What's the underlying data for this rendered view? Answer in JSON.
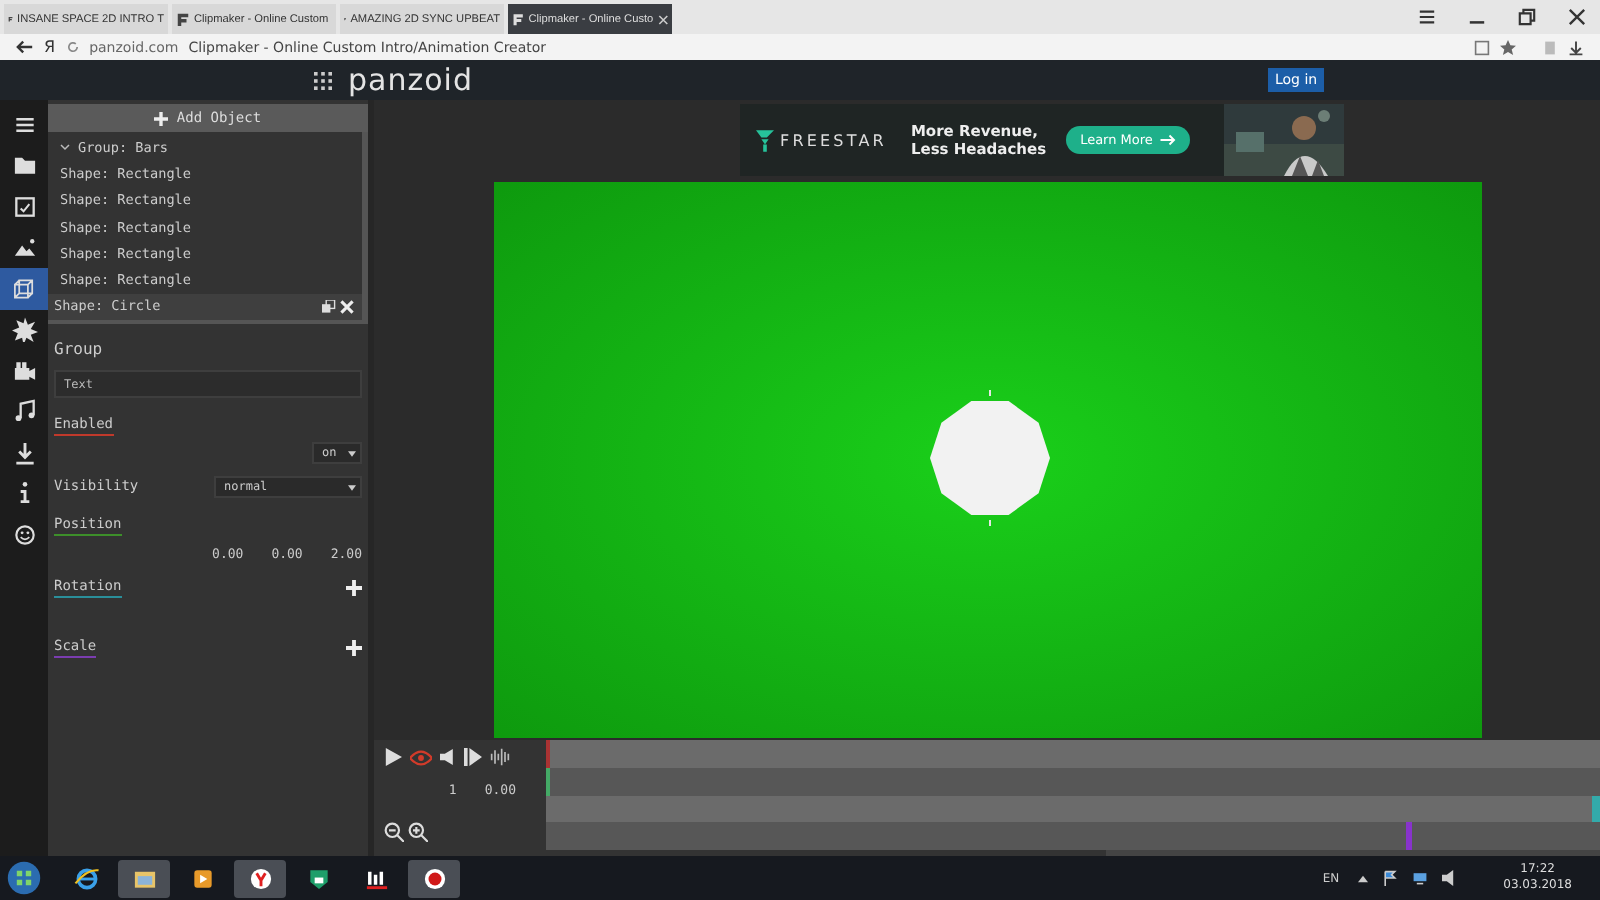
{
  "browser": {
    "tabs": [
      {
        "title": "INSANE SPACE 2D INTRO T",
        "selected": false
      },
      {
        "title": "Clipmaker - Online Custom",
        "selected": false
      },
      {
        "title": "AMAZING 2D SYNC UPBEAT",
        "selected": false
      },
      {
        "title": "Clipmaker - Online Custo",
        "selected": true
      }
    ],
    "yandex_glyph": "Я",
    "domain": "panzoid.com",
    "page_title": "Clipmaker - Online Custom Intro/Animation Creator"
  },
  "header": {
    "logo": "panzoid",
    "login": "Log in"
  },
  "sidebar": [
    {
      "kind": "menu",
      "selected": false
    },
    {
      "kind": "folder",
      "selected": false
    },
    {
      "kind": "checkbox",
      "selected": false
    },
    {
      "kind": "mountain",
      "selected": false
    },
    {
      "kind": "cube",
      "selected": true
    },
    {
      "kind": "burst",
      "selected": false
    },
    {
      "kind": "camera",
      "selected": false
    },
    {
      "kind": "music",
      "selected": false
    },
    {
      "kind": "download",
      "selected": false
    },
    {
      "kind": "info",
      "selected": false
    },
    {
      "kind": "smiley",
      "selected": false
    }
  ],
  "objects": {
    "add_label": "Add Object",
    "group": {
      "label": "Group: Bars",
      "expanded": true,
      "children": [
        {
          "label": "Shape: Rectangle",
          "selected": false
        },
        {
          "label": "Shape: Rectangle",
          "selected": false
        },
        {
          "label": "Shape: Rectangle",
          "selected": false
        },
        {
          "label": "Shape: Rectangle",
          "selected": false
        },
        {
          "label": "Shape: Rectangle",
          "selected": false
        },
        {
          "label": "Shape: Circle",
          "selected": true
        }
      ]
    }
  },
  "properties": {
    "heading": "Group",
    "items": [
      {
        "kind": "field",
        "value": "Text"
      },
      {
        "kind": "toggle",
        "label": "Enabled",
        "color": "#c0392b",
        "value": "on"
      },
      {
        "kind": "select",
        "label": "Visibility",
        "value": "normal"
      },
      {
        "kind": "vector",
        "label": "Position",
        "color": "#3d8f2a",
        "values": [
          "0.00",
          "0.00",
          "2.00"
        ]
      },
      {
        "kind": "expandable",
        "label": "Rotation",
        "color": "#2a8f9a"
      },
      {
        "kind": "expandable",
        "label": "Scale",
        "color": "#7b3db0"
      }
    ]
  },
  "ad": {
    "brand": "FREESTAR",
    "headline": "More Revenue,\nLess Headaches",
    "button": "Learn More"
  },
  "timeline": {
    "frame": "1",
    "time": "0.00"
  },
  "taskbar": {
    "apps": [
      {
        "kind": "ie",
        "active": false
      },
      {
        "kind": "explorer",
        "active": true
      },
      {
        "kind": "media",
        "active": false
      },
      {
        "kind": "yandex",
        "active": true
      },
      {
        "kind": "lock",
        "active": false
      },
      {
        "kind": "bars",
        "active": false
      },
      {
        "kind": "record",
        "active": true
      }
    ],
    "language": "EN",
    "time": "17:22",
    "date": "03.03.2018"
  }
}
